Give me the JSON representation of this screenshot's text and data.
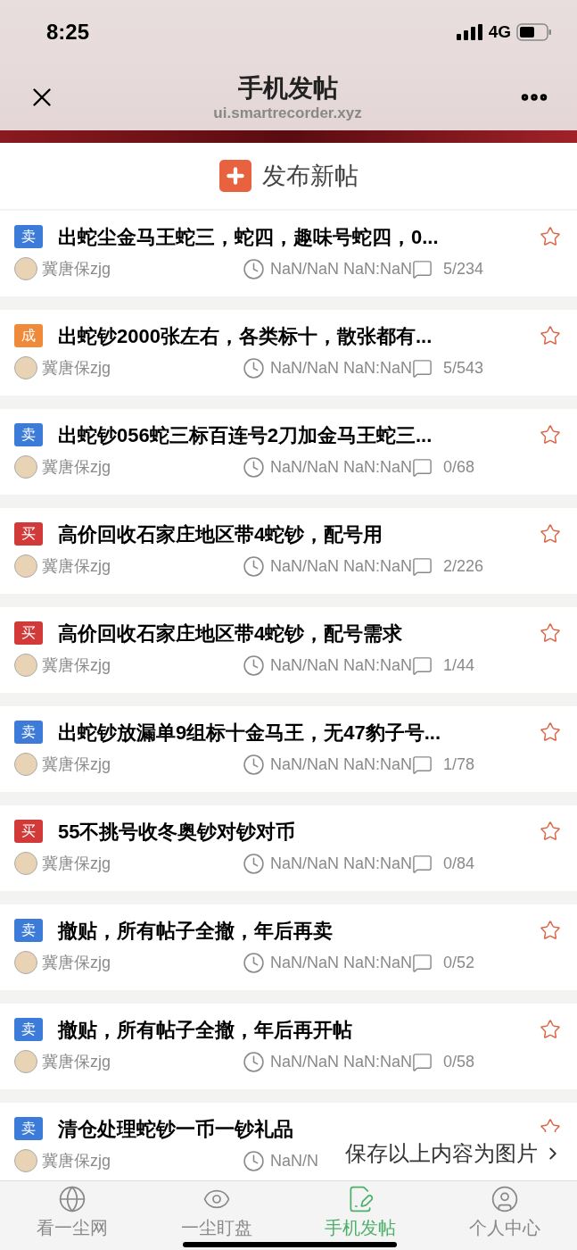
{
  "status_bar": {
    "time": "8:25",
    "network": "4G"
  },
  "nav": {
    "title": "手机发帖",
    "subtitle": "ui.smartrecorder.xyz"
  },
  "new_post": {
    "label": "发布新帖"
  },
  "posts": [
    {
      "tag": "卖",
      "color": "#3d7bd9",
      "title": "出蛇尘金马王蛇三，蛇四，趣味号蛇四，0...",
      "author": "冀唐保zjg",
      "time": "NaN/NaN NaN:NaN",
      "replies": "5/234"
    },
    {
      "tag": "成",
      "color": "#ef8a3a",
      "title": "出蛇钞2000张左右，各类标十，散张都有...",
      "author": "冀唐保zjg",
      "time": "NaN/NaN NaN:NaN",
      "replies": "5/543"
    },
    {
      "tag": "卖",
      "color": "#3d7bd9",
      "title": "出蛇钞056蛇三标百连号2刀加金马王蛇三...",
      "author": "冀唐保zjg",
      "time": "NaN/NaN NaN:NaN",
      "replies": "0/68"
    },
    {
      "tag": "买",
      "color": "#d23a3a",
      "title": "高价回收石家庄地区带4蛇钞，配号用",
      "author": "冀唐保zjg",
      "time": "NaN/NaN NaN:NaN",
      "replies": "2/226"
    },
    {
      "tag": "买",
      "color": "#d23a3a",
      "title": "高价回收石家庄地区带4蛇钞，配号需求",
      "author": "冀唐保zjg",
      "time": "NaN/NaN NaN:NaN",
      "replies": "1/44"
    },
    {
      "tag": "卖",
      "color": "#3d7bd9",
      "title": "出蛇钞放漏单9组标十金马王，无47豹子号...",
      "author": "冀唐保zjg",
      "time": "NaN/NaN NaN:NaN",
      "replies": "1/78"
    },
    {
      "tag": "买",
      "color": "#d23a3a",
      "title": "55不挑号收冬奥钞对钞对币",
      "author": "冀唐保zjg",
      "time": "NaN/NaN NaN:NaN",
      "replies": "0/84"
    },
    {
      "tag": "卖",
      "color": "#3d7bd9",
      "title": "撤贴，所有帖子全撤，年后再卖",
      "author": "冀唐保zjg",
      "time": "NaN/NaN NaN:NaN",
      "replies": "0/52"
    },
    {
      "tag": "卖",
      "color": "#3d7bd9",
      "title": "撤贴，所有帖子全撤，年后再开帖",
      "author": "冀唐保zjg",
      "time": "NaN/NaN NaN:NaN",
      "replies": "0/58"
    },
    {
      "tag": "卖",
      "color": "#3d7bd9",
      "title": "清仓处理蛇钞一币一钞礼品",
      "author": "冀唐保zjg",
      "time": "NaN/N"
    }
  ],
  "toast": {
    "label": "保存以上内容为图片"
  },
  "tabs": [
    {
      "kind": "globe",
      "label": "看一尘网",
      "selected": false
    },
    {
      "kind": "eye",
      "label": "一尘盯盘",
      "selected": false
    },
    {
      "kind": "edit",
      "label": "手机发帖",
      "selected": true
    },
    {
      "kind": "user",
      "label": "个人中心",
      "selected": false
    }
  ]
}
